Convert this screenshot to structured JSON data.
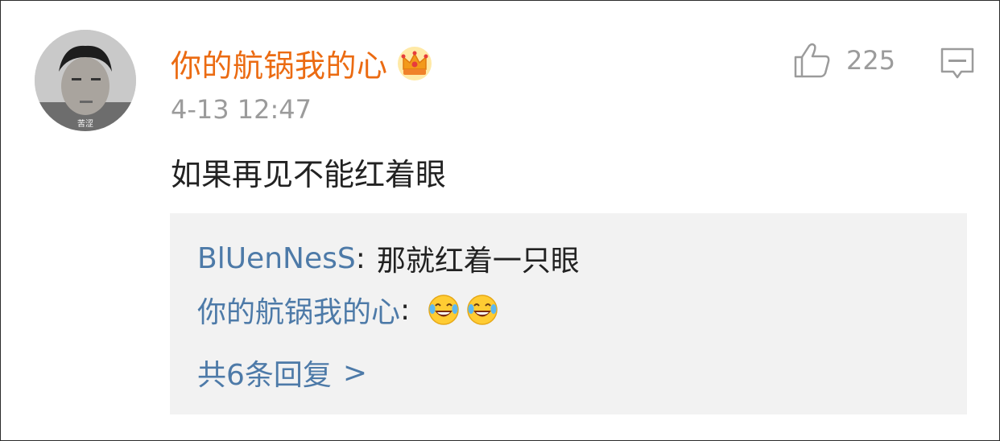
{
  "comment": {
    "username": "你的航锅我的心",
    "timestamp": "4-13 12:47",
    "text": "如果再见不能红着眼",
    "likes": "225",
    "avatar_caption": "苦涩",
    "badge_icon": "crown-icon"
  },
  "replies": [
    {
      "user": "BlUenNesS",
      "separator": ":",
      "text": "那就红着一只眼"
    },
    {
      "user": "你的航锅我的心",
      "separator": ":",
      "emojis": [
        "laugh-cry-emoji",
        "laugh-cry-emoji"
      ]
    }
  ],
  "more_replies": {
    "label": "共6条回复",
    "chevron": ">"
  },
  "colors": {
    "username": "#eb6b12",
    "reply_user": "#4d7aa8",
    "meta": "#9b9b9b",
    "reply_bg": "#f2f2f2"
  }
}
